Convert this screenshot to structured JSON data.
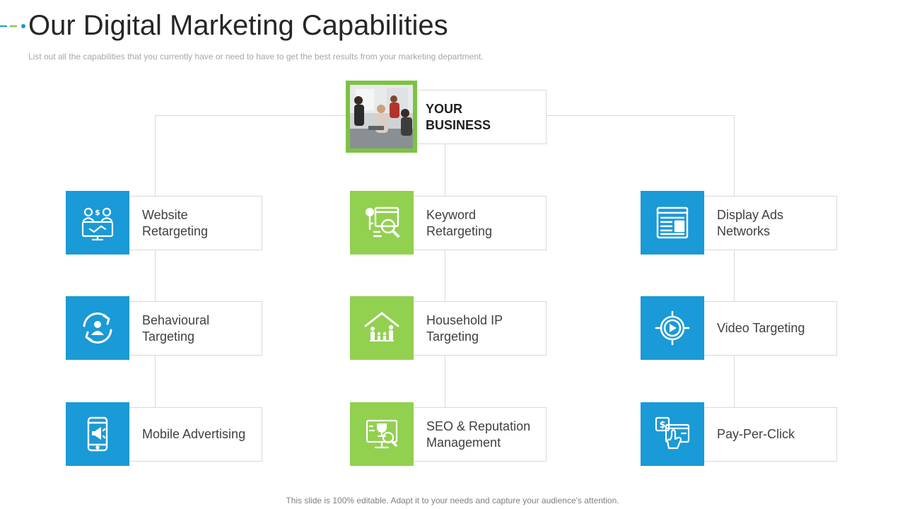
{
  "header": {
    "title": "Our Digital Marketing Capabilities",
    "subtitle": "List out all the capabilities that you currently have  or  need to have  to get the best results from your marketing department."
  },
  "root": {
    "label_line1": "YOUR",
    "label_line2": "BUSINESS",
    "image": "team-meeting-photo"
  },
  "colors": {
    "blue": "#1a9ad6",
    "green": "#92d050",
    "photo_frame": "#7dc243",
    "connector": "#d9d9d9"
  },
  "columns": [
    {
      "color": "blue",
      "items": [
        {
          "line1": "Website",
          "line2": "Retargeting",
          "icon": "website-retargeting-icon"
        },
        {
          "line1": "Behavioural",
          "line2": "Targeting",
          "icon": "user-refresh-icon"
        },
        {
          "line1": "Mobile Advertising",
          "line2": "",
          "icon": "mobile-megaphone-icon"
        }
      ]
    },
    {
      "color": "green",
      "items": [
        {
          "line1": "Keyword",
          "line2": "Retargeting",
          "icon": "keyword-search-icon"
        },
        {
          "line1": "Household IP",
          "line2": "Targeting",
          "icon": "household-family-icon"
        },
        {
          "line1": "SEO & Reputation",
          "line2": "Management",
          "icon": "seo-trophy-icon"
        }
      ]
    },
    {
      "color": "blue",
      "items": [
        {
          "line1": "Display Ads",
          "line2": "Networks",
          "icon": "browser-window-icon"
        },
        {
          "line1": "Video Targeting",
          "line2": "",
          "icon": "video-target-icon"
        },
        {
          "line1": "Pay-Per-Click",
          "line2": "",
          "icon": "pay-per-click-icon"
        }
      ]
    }
  ],
  "footer": {
    "note": "This slide is 100% editable. Adapt it to your needs and capture your audience's attention."
  }
}
